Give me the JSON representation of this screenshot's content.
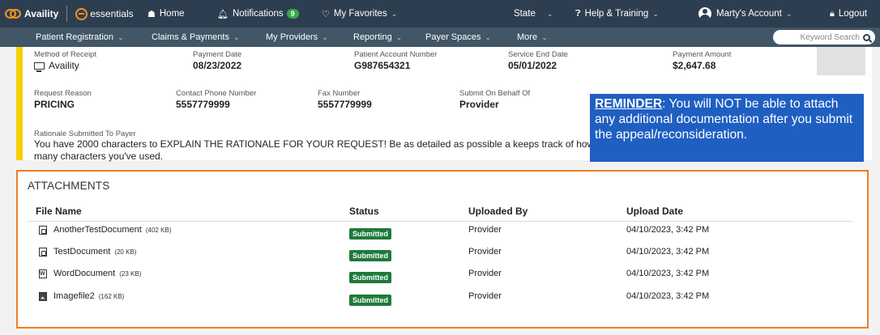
{
  "topbar": {
    "brand": "Availity",
    "essentials": "essentials",
    "home": "Home",
    "notifications": "Notifications",
    "notifications_count": "9",
    "favorites": "My Favorites",
    "state": "State",
    "help": "Help & Training",
    "account": "Marty's Account",
    "logout": "Logout"
  },
  "subnav": {
    "items": [
      "Patient Registration",
      "Claims & Payments",
      "My Providers",
      "Reporting",
      "Payer Spaces",
      "More"
    ],
    "search_placeholder": "Keyword Search"
  },
  "details": {
    "method_label": "Method of Receipt",
    "method_value": "Availity",
    "payment_date_label": "Payment Date",
    "payment_date_value": "08/23/2022",
    "patient_account_label": "Patient Account Number",
    "patient_account_value": "G987654321",
    "service_end_label": "Service End Date",
    "service_end_value": "05/01/2022",
    "payment_amount_label": "Payment Amount",
    "payment_amount_value": "$2,647.68",
    "request_reason_label": "Request Reason",
    "request_reason_value": "PRICING",
    "contact_phone_label": "Contact Phone Number",
    "contact_phone_value": "5557779999",
    "fax_label": "Fax Number",
    "fax_value": "5557779999",
    "submit_behalf_label": "Submit On Behalf Of",
    "submit_behalf_value": "Provider",
    "rationale_label": "Rationale Submitted To Payer",
    "rationale_text": "You have 2000 characters to EXPLAIN THE RATIONALE FOR YOUR REQUEST! Be as detailed as possible a keeps track of how many characters you've used."
  },
  "reminder": {
    "lead": "REMINDER",
    "body": ": You will NOT be able to attach any additional documentation after you submit the appeal/reconsideration."
  },
  "attachments": {
    "title": "ATTACHMENTS",
    "headers": [
      "File Name",
      "Status",
      "Uploaded By",
      "Upload Date"
    ],
    "rows": [
      {
        "name": "AnotherTestDocument",
        "size": "(402 KB)",
        "icon": "pdf-file-icon",
        "status": "Submitted",
        "uploaded_by": "Provider",
        "date": "04/10/2023, 3:42 PM"
      },
      {
        "name": "TestDocument",
        "size": "(20 KB)",
        "icon": "pdf-file-icon",
        "status": "Submitted",
        "uploaded_by": "Provider",
        "date": "04/10/2023, 3:42 PM"
      },
      {
        "name": "WordDocument",
        "size": "(23 KB)",
        "icon": "word-file-icon",
        "status": "Submitted",
        "uploaded_by": "Provider",
        "date": "04/10/2023, 3:42 PM"
      },
      {
        "name": "Imagefile2",
        "size": "(162 KB)",
        "icon": "image-file-icon",
        "status": "Submitted",
        "uploaded_by": "Provider",
        "date": "04/10/2023, 3:42 PM"
      }
    ]
  },
  "colors": {
    "topbar": "#2d3e50",
    "subnav": "#415666",
    "accent_yellow": "#f5d000",
    "attachments_border": "#f07c23",
    "reminder_bg": "#1f5fc2",
    "status_green": "#1e7a3a"
  }
}
